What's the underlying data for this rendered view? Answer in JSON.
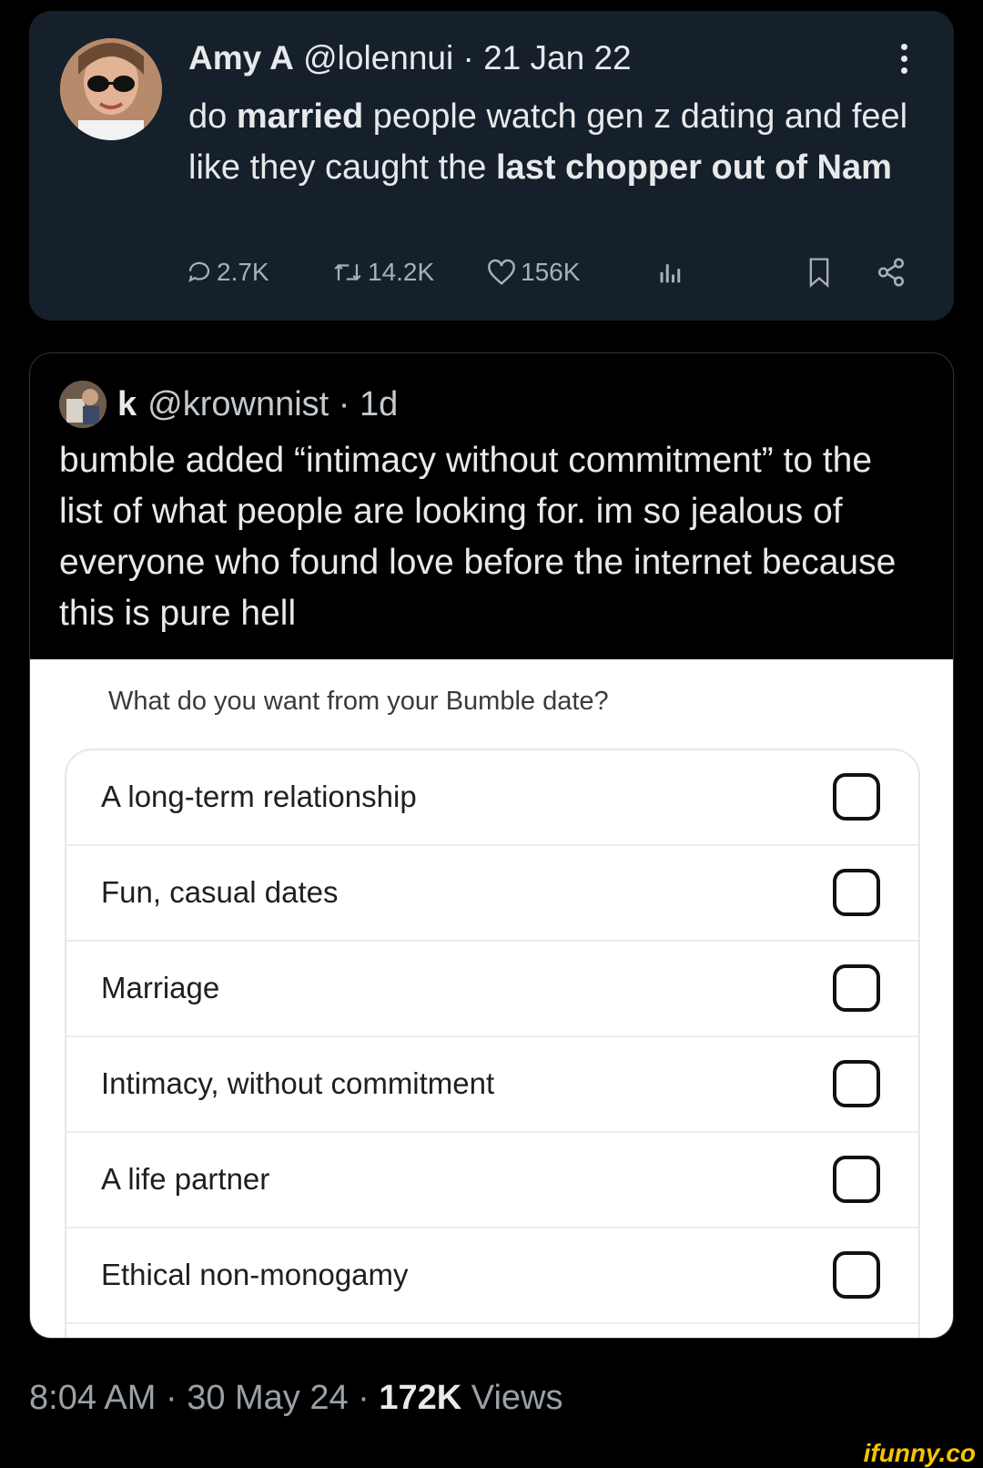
{
  "tweet": {
    "name": "Amy A",
    "meta": "@lolennui · 21 Jan 22",
    "text_parts": [
      "do ",
      "married",
      " people watch gen z dating and feel like they caught the ",
      "last chopper out of Nam"
    ],
    "actions": {
      "replies": "2.7K",
      "retweets": "14.2K",
      "likes": "156K"
    }
  },
  "quote": {
    "name": "k",
    "meta": "@krownnist · 1d",
    "text": "bumble added “intimacy without commitment” to the list of what people are looking for. im so jealous of everyone who found love before the internet because this is pure hell"
  },
  "media": {
    "question": "What do you want from your Bumble date?",
    "options": [
      {
        "label": "A long-term relationship",
        "checked": false
      },
      {
        "label": "Fun, casual dates",
        "checked": false
      },
      {
        "label": "Marriage",
        "checked": false
      },
      {
        "label": "Intimacy, without commitment",
        "checked": false
      },
      {
        "label": "A life partner",
        "checked": false
      },
      {
        "label": "Ethical non-monogamy",
        "checked": false
      }
    ]
  },
  "footer": {
    "time": "8:04 AM · 30 May 24 · ",
    "views": "172K",
    "views_label": " Views"
  },
  "brand": "ifunny.co"
}
